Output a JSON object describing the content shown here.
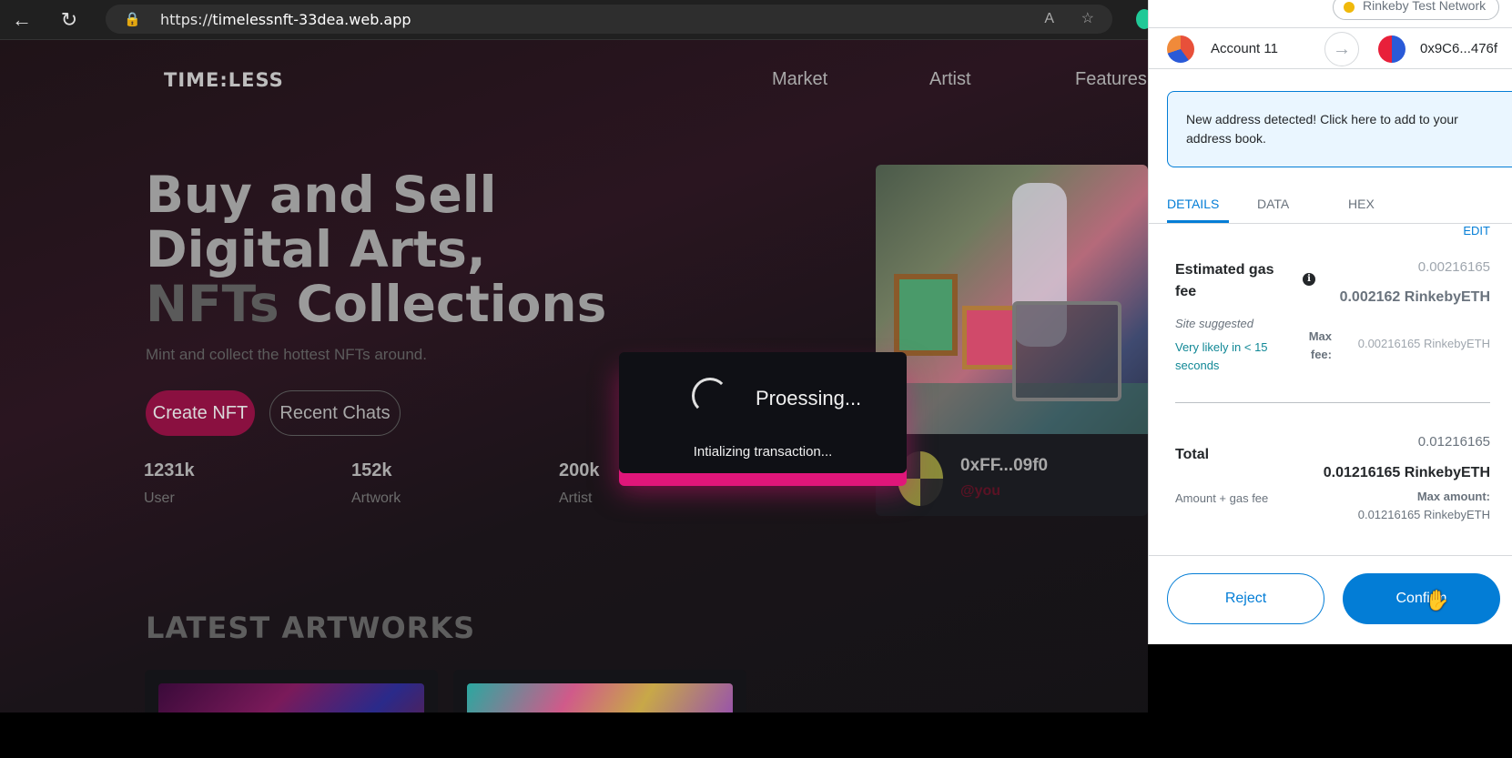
{
  "browser": {
    "url_scheme": "https://",
    "url_host": "timelessnft-33dea.web.app",
    "back_icon": "←",
    "reload_icon": "↻",
    "lock_icon": "🔒",
    "read_aloud_icon": "A",
    "favorite_icon": "☆"
  },
  "site": {
    "logo": "TIME:LESS",
    "nav": [
      "Market",
      "Artist",
      "Features"
    ],
    "hero": {
      "line1": "Buy and Sell",
      "line2": "Digital Arts,",
      "line3a": "NFTs",
      "line3b": "Collections",
      "subtitle": "Mint and collect the hottest NFTs around."
    },
    "create_button": "Create NFT",
    "chats_button": "Recent Chats",
    "stats": [
      {
        "value": "1231k",
        "label": "User"
      },
      {
        "value": "152k",
        "label": "Artwork"
      },
      {
        "value": "200k",
        "label": "Artist"
      }
    ],
    "featured": {
      "owner_address": "0xFF...09f0",
      "owner_tag": "@you"
    },
    "latest_heading": "LATEST ARTWORKS"
  },
  "processing": {
    "title": "Proessing...",
    "subtitle": "Intializing transaction..."
  },
  "wallet": {
    "network": "Rinkeby Test Network",
    "account_name": "Account 11",
    "arrow_icon": "→",
    "to_address": "0x9C6...476f",
    "notice": "New address detected! Click here to add to your address book.",
    "tabs": [
      "DETAILS",
      "DATA",
      "HEX"
    ],
    "edit": "EDIT",
    "gas_label": "Estimated gas fee",
    "info_icon": "i",
    "gas_value": "0.00216165",
    "gas_value_eth": "0.002162 RinkebyETH",
    "site_suggested": "Site suggested",
    "likely": "Very likely in < 15 seconds",
    "max_fee_label": "Max fee:",
    "max_fee_value": "0.00216165 RinkebyETH",
    "total_label": "Total",
    "total_value": "0.01216165",
    "total_value_eth": "0.01216165 RinkebyETH",
    "amount_gas_label": "Amount + gas fee",
    "max_amount_label": "Max amount:",
    "max_amount_value": "0.01216165 RinkebyETH",
    "reject_button": "Reject",
    "confirm_button": "Confirm"
  },
  "colors": {
    "accent_pink": "#e0167a",
    "metamask_blue": "#037dd6"
  }
}
